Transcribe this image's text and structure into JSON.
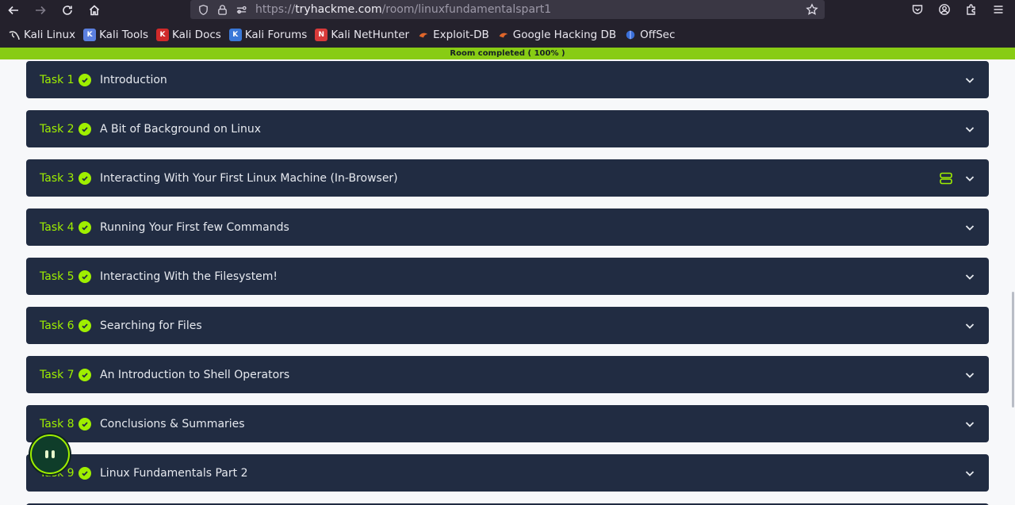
{
  "browser": {
    "url_scheme": "https://",
    "url_host": "tryhackme.com",
    "url_path": "/room/linuxfundamentalspart1",
    "bookmarks": [
      {
        "label": "Kali Linux",
        "icon": "kali-icon",
        "color": "#ffffff"
      },
      {
        "label": "Kali Tools",
        "icon": "kali-tools-icon",
        "color": "#5b7fe0"
      },
      {
        "label": "Kali Docs",
        "icon": "kali-docs-icon",
        "color": "#d02a2a"
      },
      {
        "label": "Kali Forums",
        "icon": "kali-forums-icon",
        "color": "#3a78d8"
      },
      {
        "label": "Kali NetHunter",
        "icon": "nethunter-icon",
        "color": "#d83a3a"
      },
      {
        "label": "Exploit-DB",
        "icon": "exploit-db-icon",
        "color": "#e0662a"
      },
      {
        "label": "Google Hacking DB",
        "icon": "ghdb-icon",
        "color": "#e0662a"
      },
      {
        "label": "OffSec",
        "icon": "offsec-icon",
        "color": "#3a6fd8"
      }
    ]
  },
  "progress": {
    "label": "Room completed ( 100% )",
    "value": 100,
    "color": "#88cc14"
  },
  "tasks": [
    {
      "number": "Task 1",
      "title": "Introduction",
      "completed": true
    },
    {
      "number": "Task 2",
      "title": "A Bit of Background on Linux",
      "completed": true
    },
    {
      "number": "Task 3",
      "title": "Interacting With Your First Linux Machine (In-Browser)",
      "completed": true,
      "machine": true
    },
    {
      "number": "Task 4",
      "title": "Running Your First few Commands",
      "completed": true
    },
    {
      "number": "Task 5",
      "title": "Interacting With the Filesystem!",
      "completed": true
    },
    {
      "number": "Task 6",
      "title": "Searching for Files",
      "completed": true
    },
    {
      "number": "Task 7",
      "title": "An Introduction to Shell Operators",
      "completed": true
    },
    {
      "number": "Task 8",
      "title": "Conclusions & Summaries",
      "completed": true
    },
    {
      "number": "Task 9",
      "title": "Linux Fundamentals Part 2",
      "completed": true
    }
  ],
  "colors": {
    "task_bg": "#212c42",
    "accent": "#9fef00",
    "page_bg": "#f7f8fa"
  }
}
